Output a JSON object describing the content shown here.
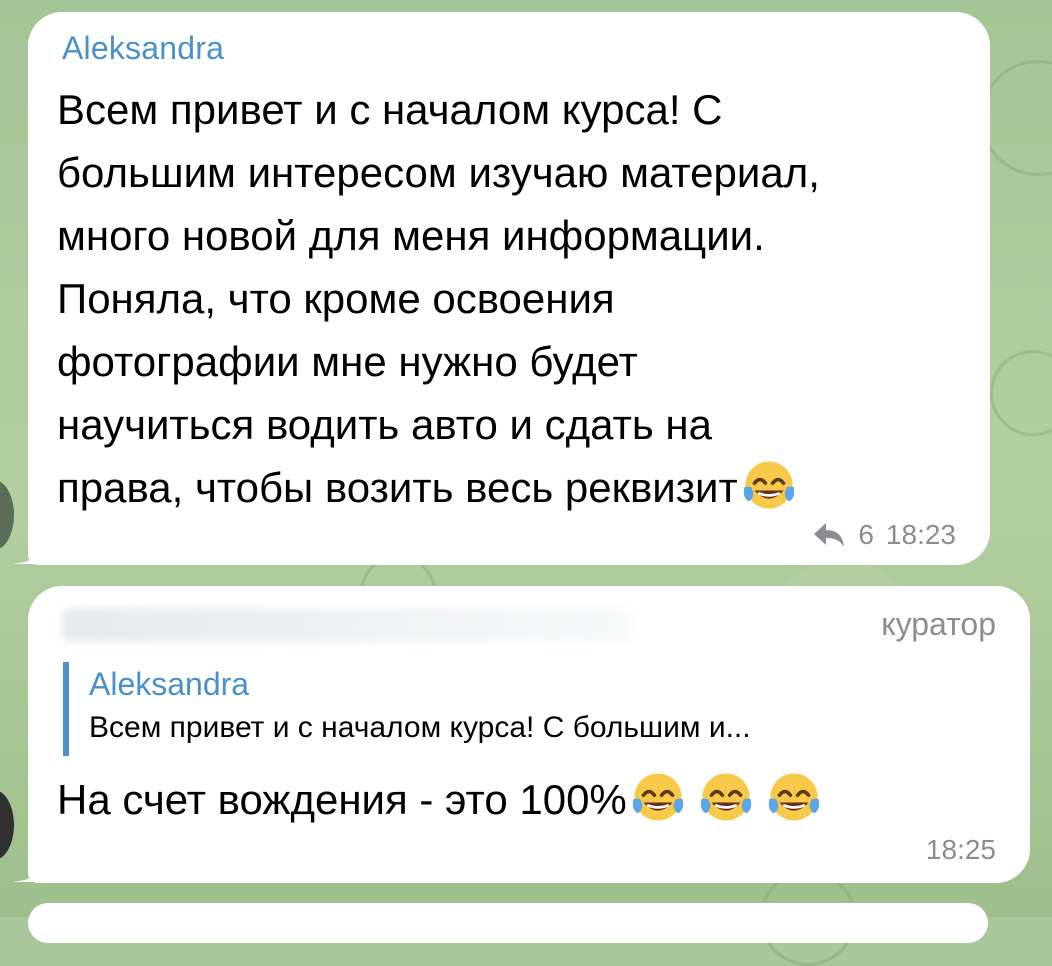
{
  "messages": [
    {
      "sender": "Aleksandra",
      "text": "Всем привет и с началом курса! С\nбольшим интересом изучаю материал,\nмного новой для меня информации.\nПоняла, что кроме освоения\nфотографии мне нужно будет\nнаучиться водить авто и сдать на\nправа, чтобы возить весь реквизит",
      "emoji": "face-with-tears-of-joy",
      "reply_count": "6",
      "time": "18:23"
    },
    {
      "role_badge": "куратор",
      "reply_to": {
        "sender": "Aleksandra",
        "text": "Всем привет и с началом курса! С большим и..."
      },
      "text": "На счет вождения - это 100%",
      "emoji_count": 3,
      "emoji": "face-with-tears-of-joy",
      "time": "18:25"
    }
  ],
  "colors": {
    "sender_name": "#4a90c9",
    "meta_text": "#8a8e94",
    "bubble": "#ffffff",
    "background": "#a9c79a"
  }
}
